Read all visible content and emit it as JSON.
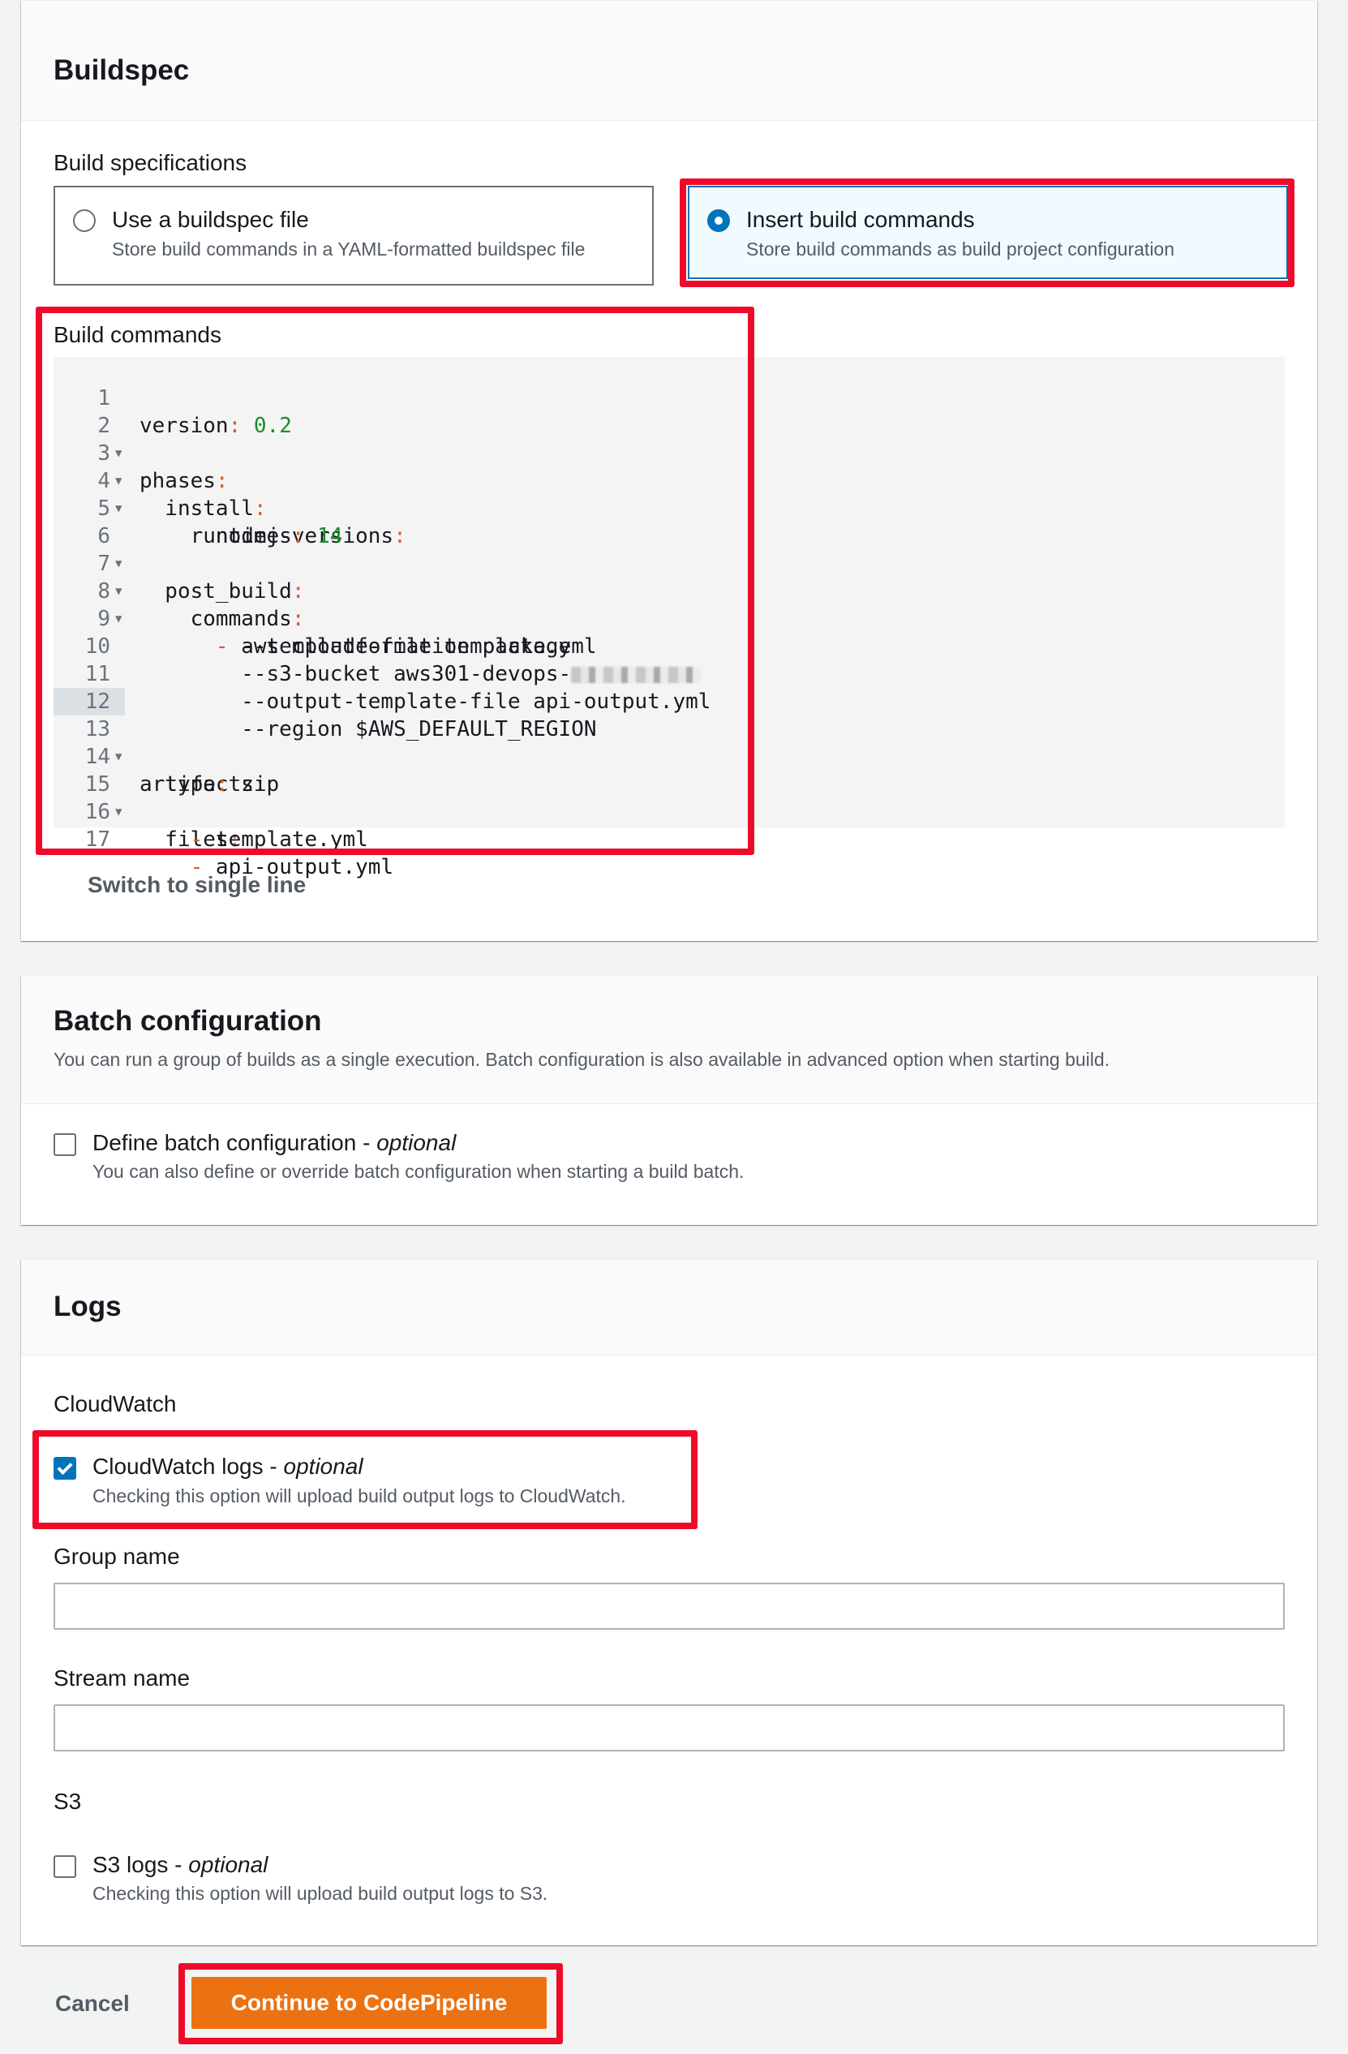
{
  "buildspec": {
    "title": "Buildspec",
    "spec_label": "Build specifications",
    "option_file": {
      "title": "Use a buildspec file",
      "desc": "Store build commands in a YAML-formatted buildspec file",
      "selected": false
    },
    "option_insert": {
      "title": "Insert build commands",
      "desc": "Store build commands as build project configuration",
      "selected": true
    },
    "commands_label": "Build commands",
    "code": {
      "lines": [
        {
          "n": "1",
          "text": "version: 0.2"
        },
        {
          "n": "2",
          "text": "phases:"
        },
        {
          "n": "3",
          "text": "  install:"
        },
        {
          "n": "4",
          "text": "    runtime-versions:"
        },
        {
          "n": "5",
          "text": "      nodejs: 14"
        },
        {
          "n": "6",
          "text": "  post_build:"
        },
        {
          "n": "7",
          "text": "    commands:"
        },
        {
          "n": "8",
          "text": "      - aws cloudformation package"
        },
        {
          "n": "9",
          "text": "        --template-file template.yml"
        },
        {
          "n": "10",
          "text": "        --s3-bucket aws301-devops-"
        },
        {
          "n": "11",
          "text": "        --output-template-file api-output.yml"
        },
        {
          "n": "12",
          "text": "        --region $AWS_DEFAULT_REGION"
        },
        {
          "n": "13",
          "text": "artifacts:"
        },
        {
          "n": "14",
          "text": "  type: zip"
        },
        {
          "n": "15",
          "text": "  files:"
        },
        {
          "n": "16",
          "text": "    - template.yml"
        },
        {
          "n": "17",
          "text": "    - api-output.yml"
        }
      ]
    },
    "switch_link": "Switch to single line"
  },
  "batch": {
    "title": "Batch configuration",
    "desc": "You can run a group of builds as a single execution. Batch configuration is also available in advanced option when starting build.",
    "checkbox_label": "Define batch configuration",
    "checkbox_sep": " - ",
    "optional": "optional",
    "checkbox_desc": "You can also define or override batch configuration when starting a build batch.",
    "checked": false
  },
  "logs": {
    "title": "Logs",
    "cloudwatch_label": "CloudWatch",
    "cloudwatch_checkbox": "CloudWatch logs",
    "sep": " - ",
    "optional": "optional",
    "cloudwatch_desc": "Checking this option will upload build output logs to CloudWatch.",
    "cloudwatch_checked": true,
    "group_label": "Group name",
    "group_value": "",
    "stream_label": "Stream name",
    "stream_value": "",
    "s3_label": "S3",
    "s3_checkbox": "S3 logs",
    "s3_desc": "Checking this option will upload build output logs to S3.",
    "s3_checked": false
  },
  "footer": {
    "cancel": "Cancel",
    "continue": "Continue to CodePipeline"
  },
  "colors": {
    "accent": "#0073bb",
    "primary_button": "#ec7211",
    "highlight": "#ee0b2a",
    "key_separator": "#d85a2a",
    "number": "#1a8c26"
  }
}
